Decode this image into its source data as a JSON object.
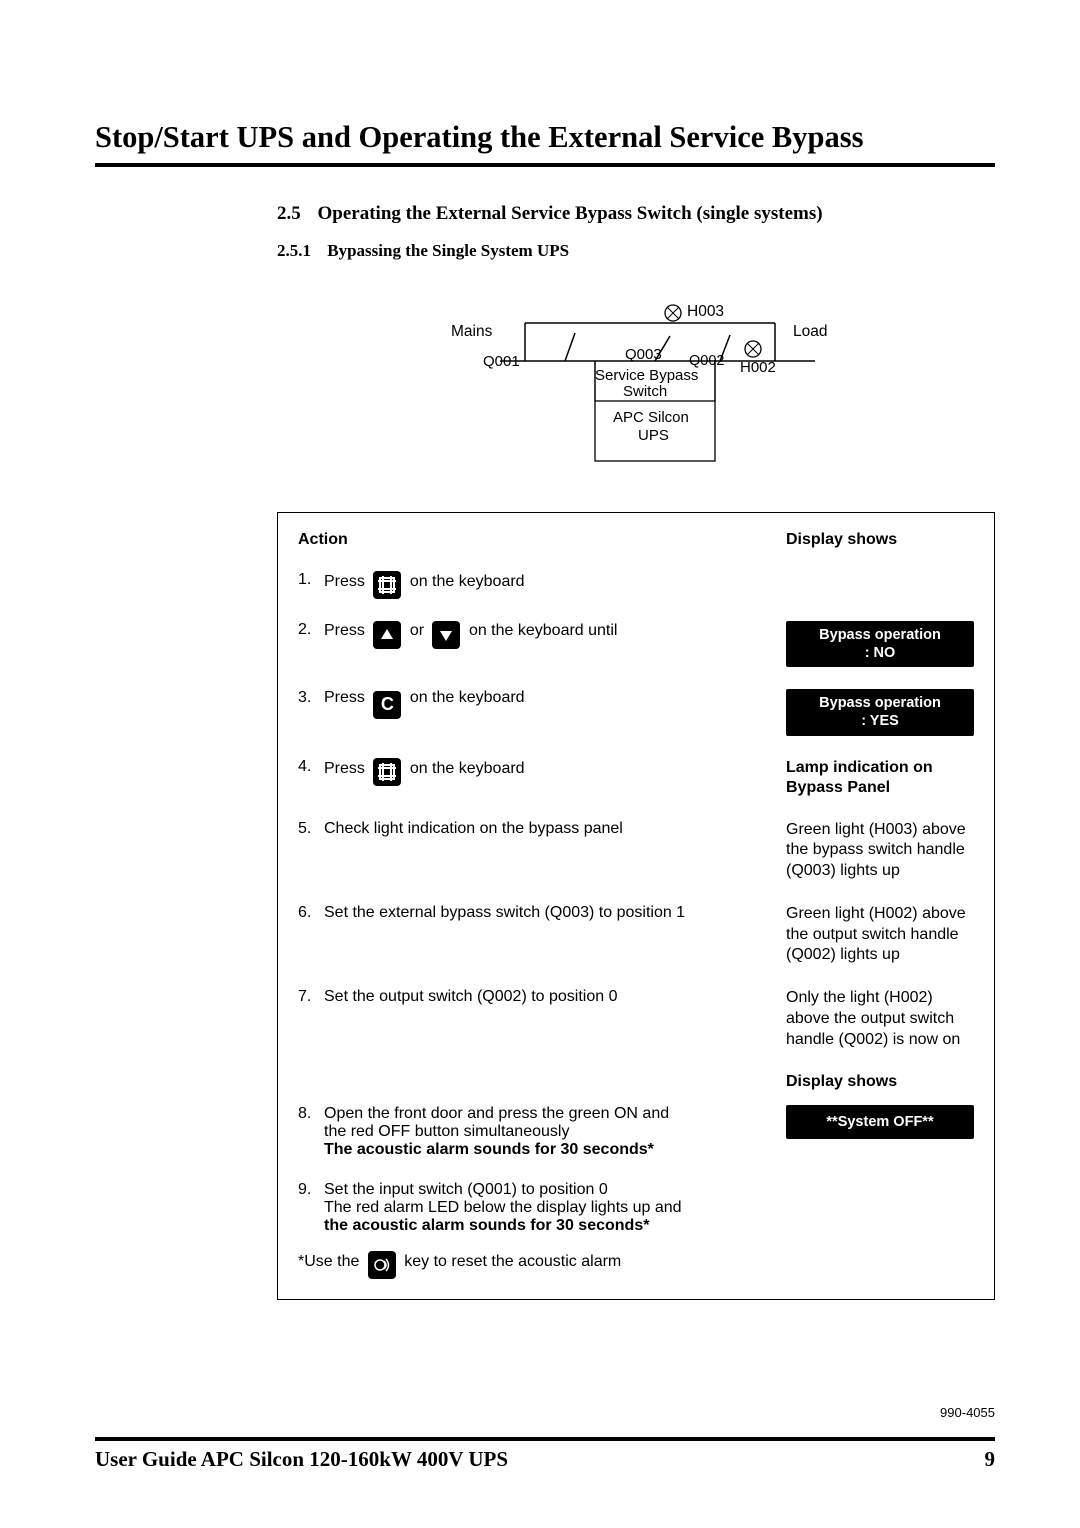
{
  "chapter_title": "Stop/Start UPS and Operating the External Service Bypass",
  "section": {
    "number": "2.5",
    "title": "Operating the External Service Bypass Switch (single systems)"
  },
  "subsection": {
    "number": "2.5.1",
    "title": "Bypassing the Single System UPS"
  },
  "diagram": {
    "mains": "Mains",
    "load": "Load",
    "q001": "Q001",
    "q002": "Q002",
    "q003": "Q003",
    "h002": "H002",
    "h003": "H003",
    "service_bypass": "Service Bypass",
    "switch": "Switch",
    "ups_name": "APC Silcon",
    "ups": "UPS"
  },
  "headers": {
    "action": "Action",
    "display": "Display shows",
    "lamp": "Lamp indication on",
    "lamp2": "Bypass Panel",
    "display2": "Display shows"
  },
  "rows": {
    "r1": {
      "num": "1.",
      "pre": "Press",
      "post": " on the keyboard"
    },
    "r2": {
      "num": "2.",
      "pre": "Press",
      "mid": " or ",
      "post": " on the keyboard until",
      "disp1": "Bypass operation",
      "disp2": ": NO"
    },
    "r3": {
      "num": "3.",
      "pre": "Press",
      "post": " on the keyboard",
      "disp1": "Bypass operation",
      "disp2": ": YES"
    },
    "r4": {
      "num": "4.",
      "pre": "Press",
      "post": " on the keyboard"
    },
    "r5": {
      "num": "5.",
      "txt": "Check light indication on the bypass panel",
      "disp": "Green light (H003) above the bypass switch handle (Q003) lights up"
    },
    "r6": {
      "num": "6.",
      "txt": "Set the external bypass switch (Q003) to position 1",
      "disp": "Green light (H002) above the output switch handle (Q002) lights up"
    },
    "r7": {
      "num": "7.",
      "txt": "Set the output switch (Q002) to position 0",
      "disp": "Only the light (H002) above the output switch handle (Q002) is now on"
    },
    "r8": {
      "num": "8.",
      "txt1": "Open the front door and press the green ON and the red OFF button simultaneously",
      "boldline": "The acoustic alarm sounds for 30 seconds*",
      "disp": "**System OFF**"
    },
    "r9": {
      "num": "9.",
      "txt1": "Set the input switch (Q001) to position 0",
      "txt2": "The red alarm LED below the display lights up and",
      "boldline": "the acoustic alarm sounds for 30 seconds*"
    },
    "note": {
      "pre": "*Use the ",
      "post": " key  to reset the acoustic alarm"
    }
  },
  "footer": {
    "guide": "User Guide APC Silcon 120-160kW 400V UPS",
    "page": "9",
    "docnum": "990-4055"
  }
}
